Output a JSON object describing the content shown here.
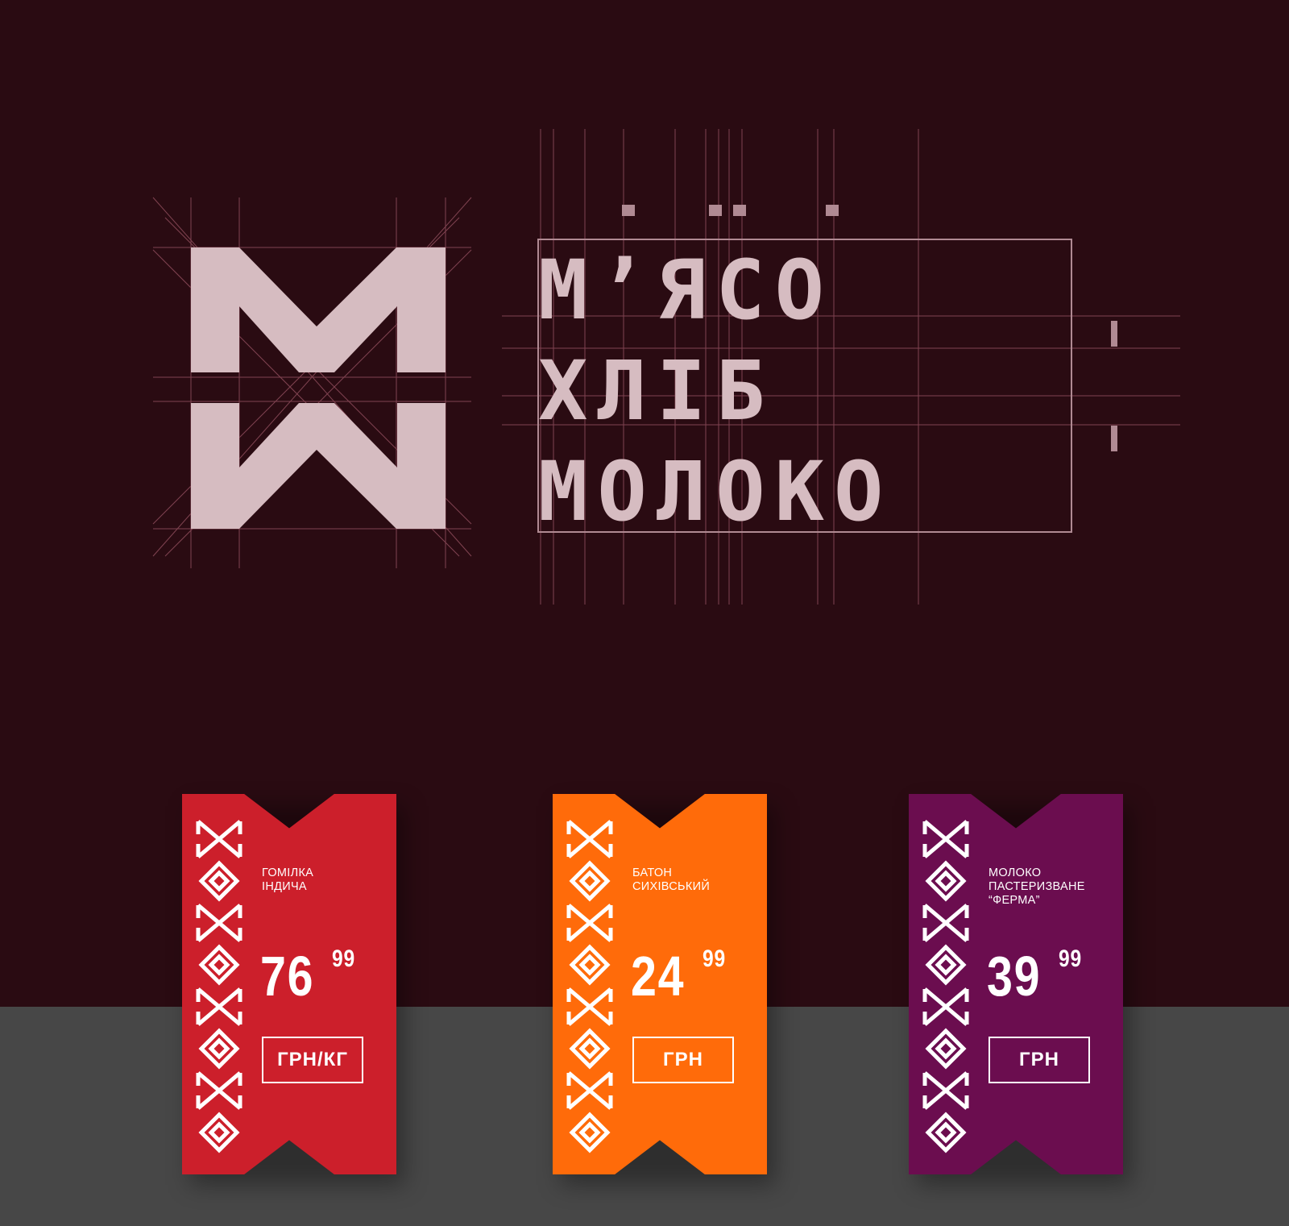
{
  "brand": {
    "monogram_icon": "mx-monogram-icon",
    "wordmark_lines": [
      "М’ЯСО",
      "ХЛІБ",
      "МОЛОКО"
    ],
    "colors": {
      "background": "#2a0b12",
      "logo": "#d6bcc1",
      "guides": "#8a4a58"
    }
  },
  "price_tags": [
    {
      "name": "ГОМІЛКА\nІНДИЧА",
      "price_main": "76",
      "price_cents": "99",
      "unit": "ГРН/КГ",
      "color": "#cc1f2b"
    },
    {
      "name": "БАТОН\nСИХІВСЬКИЙ",
      "price_main": "24",
      "price_cents": "99",
      "unit": "ГРН",
      "color": "#ff6b0a"
    },
    {
      "name": "МОЛОКО\nПАСТЕРИЗВАНЕ\n“ФЕРМА”",
      "price_main": "39",
      "price_cents": "99",
      "unit": "ГРН",
      "color": "#6b0d4f"
    }
  ],
  "ornament_icon": "embroidery-ornament-icon"
}
